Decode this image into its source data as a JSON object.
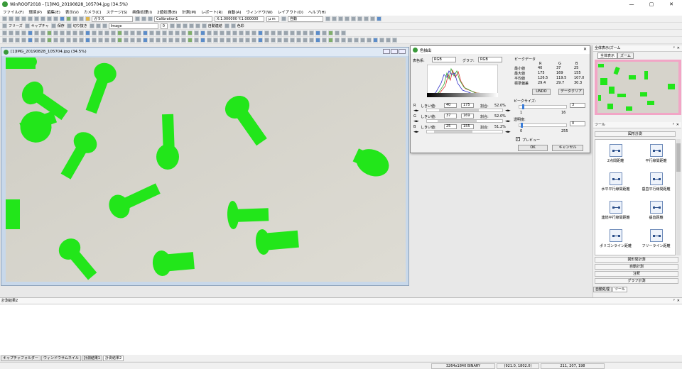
{
  "app": {
    "title": "WinROOF2018 - [1]IMG_20190828_105704.jpg (34.5%)",
    "minimize": "—",
    "restore": "▢",
    "close": "✕"
  },
  "menu": [
    "ファイル(F)",
    "環境(P)",
    "編集(E)",
    "表示(V)",
    "カメラ(C)",
    "ステージ(S)",
    "画像処理(I)",
    "2値処理(B)",
    "計測(M)",
    "レポート(R)",
    "自動(A)",
    "ウィンドウ(W)",
    "レイアウト(O)",
    "ヘルプ(H)"
  ],
  "toolbar": {
    "glass_label": "ガラス",
    "calibration": "Calibration1",
    "scale_readout": "X:1.000000 Y:1.000000",
    "unit": "μ m",
    "auto_label": "自動",
    "freeze_label": "フリーズ",
    "capture_label": "キャプチャ",
    "save_label": "保存",
    "cut_label": "切り抜き",
    "image_mode": "Image",
    "threshold_value": "0",
    "stitch_label": "自動連結",
    "color_label": "色彩"
  },
  "image_window": {
    "title": "[1]IMG_20190828_105704.jpg (34.5%)"
  },
  "dialog": {
    "title": "色抽出",
    "color_system_label": "表色系:",
    "color_system_value": "RGB",
    "graph_label": "グラフ:",
    "graph_value": "RGB",
    "peak_data_label": "ピークデータ",
    "col_r": "R",
    "col_g": "G",
    "col_b": "B",
    "stats": [
      {
        "label": "最小値",
        "r": "40",
        "g": "37",
        "b": "25"
      },
      {
        "label": "最大値",
        "r": "175",
        "g": "169",
        "b": "155"
      },
      {
        "label": "平均値",
        "r": "126.5",
        "g": "119.5",
        "b": "107.0"
      },
      {
        "label": "標準偏差",
        "r": "29.4",
        "g": "29.7",
        "b": "30.3"
      }
    ],
    "undo": "UNDO",
    "peak_clear": "データクリア",
    "channels": [
      {
        "ch": "R",
        "lbl": "しきい値:",
        "lo": "40",
        "hi": "175",
        "ratio_lbl": "割合:",
        "ratio": "52.0%"
      },
      {
        "ch": "G",
        "lbl": "しきい値:",
        "lo": "37",
        "hi": "169",
        "ratio_lbl": "割合:",
        "ratio": "52.0%"
      },
      {
        "ch": "B",
        "lbl": "しきい値:",
        "lo": "25",
        "hi": "155",
        "ratio_lbl": "割合:",
        "ratio": "51.2%"
      }
    ],
    "peak_size_label": "ピークサイズ:",
    "peak_size": "3",
    "peak_min": "1",
    "peak_max": "16",
    "transp_label": "透明度:",
    "transp": "0",
    "transp_min": "0",
    "transp_max": "255",
    "preview_label": "プレビュー",
    "preview_checked": true,
    "ok": "OK",
    "cancel": "キャンセル",
    "close": "✕"
  },
  "right_panel": {
    "overview_title": "全体表示/ズーム",
    "tab_all": "全体表示",
    "tab_zoom": "ズーム",
    "tools_title": "ツール",
    "section_top": "図形計測",
    "tools": [
      "2点間距離",
      "平行線間距離",
      "水平平行線間距離",
      "垂直平行線間距離",
      "連続平行線間距離",
      "垂直距離",
      "ポリゴンライン距離",
      "フリーライン距離"
    ],
    "sections": [
      "図形間計測",
      "自動計測",
      "注釈",
      "グラフ計測"
    ],
    "tabs_bottom": [
      "自動処理",
      "ツール"
    ],
    "pin": "ᵖ",
    "close": "✕"
  },
  "result": {
    "title": "計測結果2",
    "pin": "ᵖ",
    "close": "✕"
  },
  "bottom_tabs": [
    "キャプチャフォルダー",
    "ウィンドウサムネイル",
    "計測結果1",
    "計測結果2"
  ],
  "status": {
    "mode": "3264x1840 BINARY",
    "coord": "(921.0, 1802.0)",
    "rgb": "211, 207, 198"
  },
  "colors": {
    "highlight": "#22e61a",
    "background": "#d8d5cd",
    "accent": "#3a9a3a"
  }
}
